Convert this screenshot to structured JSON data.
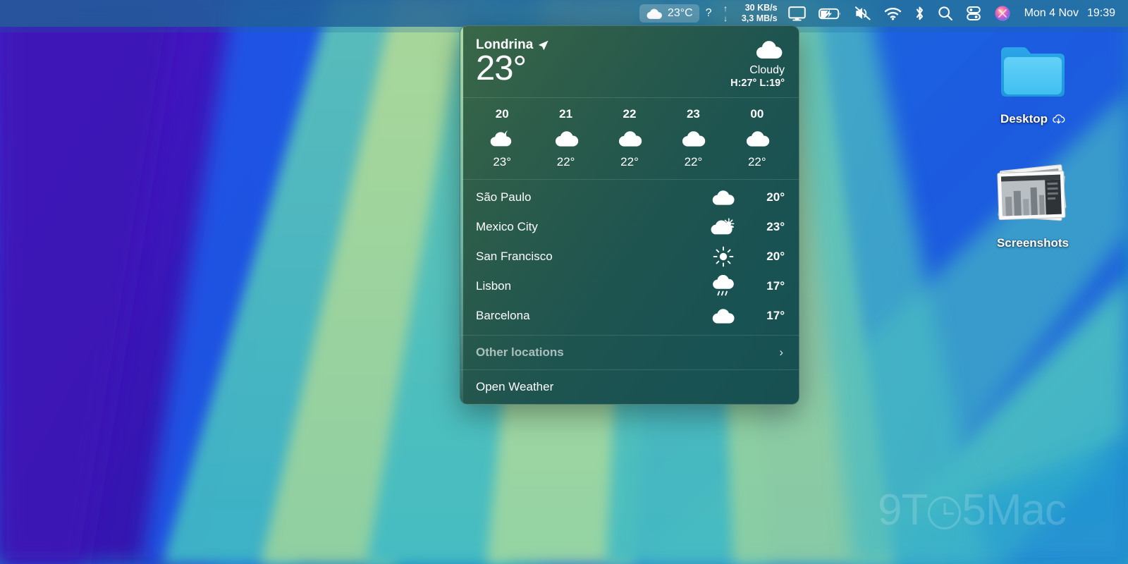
{
  "menubar": {
    "weather": {
      "label": "23°C",
      "icon": "cloud-icon",
      "active": true
    },
    "help": {
      "label": "?",
      "icon": "question-mark-icon"
    },
    "network": {
      "up_arrow": "↑",
      "up_speed": "30 KB/s",
      "down_arrow": "↓",
      "down_speed": "3,3 MB/s"
    },
    "display_icon": "display-icon",
    "battery_icon": "battery-charging-icon",
    "sound_icon": "speaker-muted-icon",
    "wifi_icon": "wifi-icon",
    "bluetooth_icon": "bluetooth-icon",
    "search_icon": "search-icon",
    "control_center_icon": "control-center-icon",
    "siri_icon": "siri-icon",
    "date": "Mon 4 Nov",
    "time": "19:39"
  },
  "weather_panel": {
    "location": "Londrina",
    "location_icon": "location-arrow-icon",
    "current_temp": "23°",
    "condition_icon": "cloud-icon",
    "condition": "Cloudy",
    "high_low": "H:27° L:19°",
    "hourly": [
      {
        "hour": "20",
        "icon": "cloud-moon-icon",
        "temp": "23°"
      },
      {
        "hour": "21",
        "icon": "cloud-icon",
        "temp": "22°"
      },
      {
        "hour": "22",
        "icon": "cloud-icon",
        "temp": "22°"
      },
      {
        "hour": "23",
        "icon": "cloud-icon",
        "temp": "22°"
      },
      {
        "hour": "00",
        "icon": "cloud-icon",
        "temp": "22°"
      }
    ],
    "cities": [
      {
        "name": "São Paulo",
        "icon": "cloud-icon",
        "temp": "20°"
      },
      {
        "name": "Mexico City",
        "icon": "cloud-sun-icon",
        "temp": "23°"
      },
      {
        "name": "San Francisco",
        "icon": "sun-icon",
        "temp": "20°"
      },
      {
        "name": "Lisbon",
        "icon": "cloud-rain-icon",
        "temp": "17°"
      },
      {
        "name": "Barcelona",
        "icon": "cloud-icon",
        "temp": "17°"
      }
    ],
    "other_locations": {
      "label": "Other locations",
      "chevron": "›"
    },
    "open_weather": {
      "label": "Open Weather"
    }
  },
  "desktop": {
    "icons": [
      {
        "name": "Desktop",
        "type": "folder",
        "badge": "icloud-download-icon"
      },
      {
        "name": "Screenshots",
        "type": "stack",
        "badge": ""
      }
    ],
    "watermark_left": "9T",
    "watermark_right": "5Mac"
  },
  "colors": {
    "panel_green": "#2c5c4a",
    "panel_teal": "#185052",
    "menubar_blue": "#236096",
    "folder_blue": "#4fc3f7"
  }
}
